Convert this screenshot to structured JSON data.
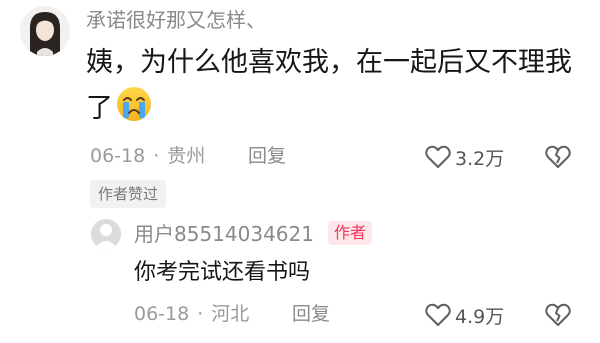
{
  "comment": {
    "username": "承诺很好那又怎样、",
    "text": "姨，为什么他喜欢我，在一起后又不理我了",
    "emoji": "crying-face",
    "date": "06-18",
    "separator": "·",
    "location": "贵州",
    "reply_label": "回复",
    "likes": "3.2万",
    "author_liked_badge": "作者赞过"
  },
  "reply": {
    "username": "用户85514034621",
    "author_tag": "作者",
    "text": "你考完试还看书吗",
    "date": "06-18",
    "separator": "·",
    "location": "河北",
    "reply_label": "回复",
    "likes": "4.9万"
  },
  "colors": {
    "text_primary": "#161616",
    "text_secondary": "#8a8a8a",
    "author_tag_bg": "#fde7ea",
    "author_tag_fg": "#f0385a"
  }
}
